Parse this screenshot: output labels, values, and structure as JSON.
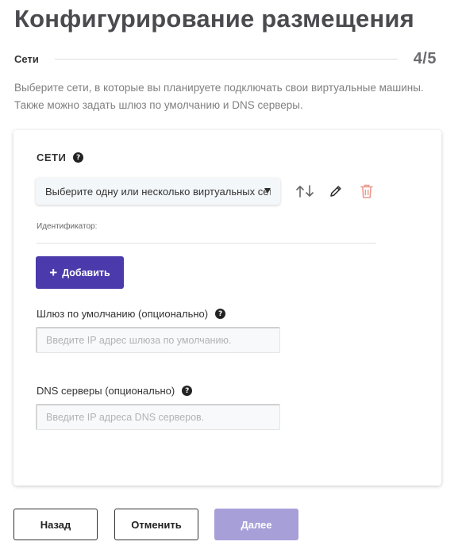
{
  "page": {
    "title": "Конфигурирование размещения",
    "step_name": "Сети",
    "step_counter": "4/5",
    "description": "Выберите сети, в которые вы планируете подключать свои виртуальные машины. Также можно задать шлюз по умолчанию и DNS серверы."
  },
  "networks": {
    "section_title": "СЕТИ",
    "help_icon": "question-circle-icon",
    "select_value": "Выберите одну или несколько виртуальных сетей",
    "identifier_label": "Идентификатор:",
    "actions": {
      "sort_icon": "sort-up-down-icon",
      "edit_icon": "pencil-icon",
      "delete_icon": "trash-icon",
      "delete_color": "#e8998d"
    },
    "add_button": "Добавить"
  },
  "gateway": {
    "label": "Шлюз по умолчанию (опционально)",
    "placeholder": "Введите IP адрес шлюза по умолчанию."
  },
  "dns": {
    "label": "DNS серверы (опционально)",
    "placeholder": "Введите IP адреса DNS серверов."
  },
  "footer": {
    "back": "Назад",
    "cancel": "Отменить",
    "next": "Далее"
  },
  "colors": {
    "accent": "#4a3aab",
    "accent_disabled": "#a79fd8"
  }
}
